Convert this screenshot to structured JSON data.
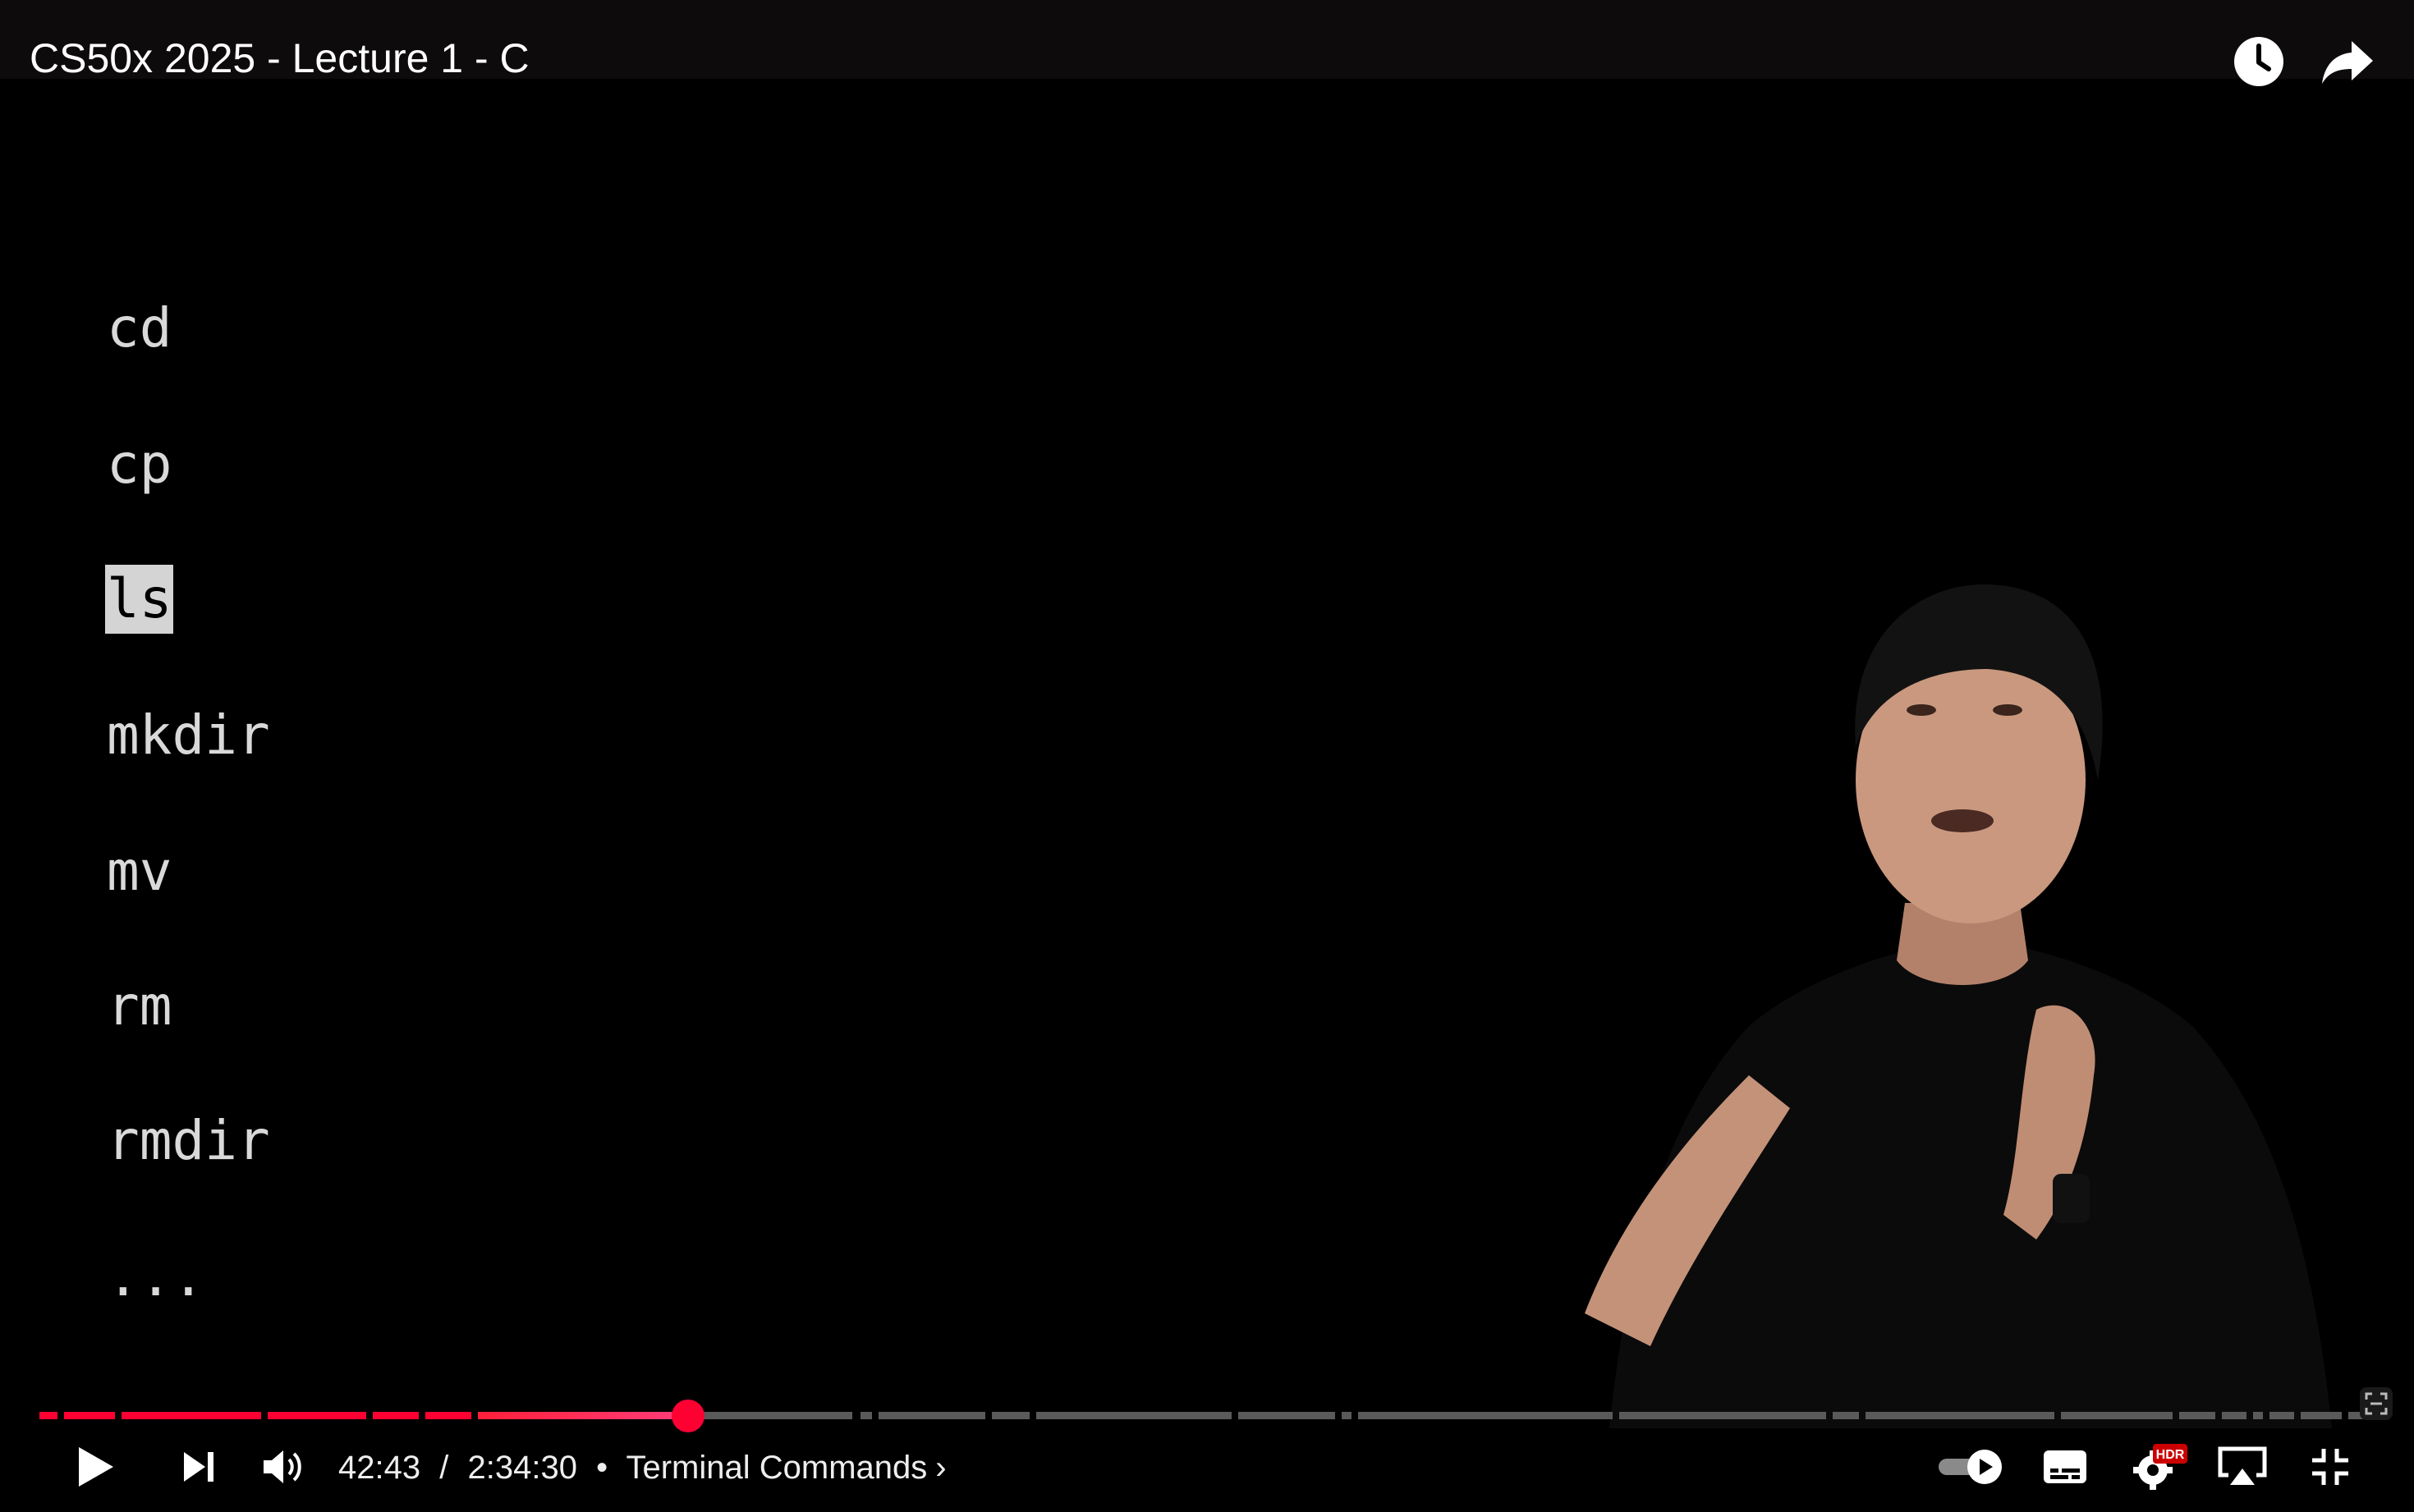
{
  "video": {
    "title": "CS50x 2025 - Lecture 1 - C"
  },
  "top_actions": {
    "watch_later_icon": "clock-icon",
    "share_icon": "share-arrow-icon"
  },
  "slide": {
    "commands": [
      "cd",
      "cp",
      "ls",
      "mkdir",
      "mv",
      "rm",
      "rmdir",
      "..."
    ],
    "highlighted": "ls"
  },
  "progress": {
    "played_fraction": 0.276
  },
  "controls": {
    "current_time": "42:43",
    "separator": "/",
    "duration": "2:34:30",
    "bullet": "•",
    "chapter": "Terminal Commands",
    "chapter_chevron": "›",
    "hdr_badge": "HDR"
  },
  "colors": {
    "accent": "#ff0033",
    "background": "#000000"
  }
}
